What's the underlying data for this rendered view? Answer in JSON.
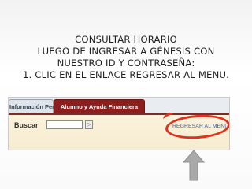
{
  "instructions": {
    "line1": "CONSULTAR HORARIO",
    "line2": "LUEGO DE INGRESAR A GÉNESIS CON",
    "line3": "NUESTRO ID Y CONTRASEÑA:",
    "line4": "1. CLIC EN EL ENLACE REGRESAR AL MENU."
  },
  "screenshot": {
    "tabs": [
      {
        "label": "Información Personal"
      },
      {
        "label": "Alumno y Ayuda Financiera"
      }
    ],
    "search_label": "Buscar",
    "search_value": "",
    "go_button_label": "▷",
    "return_link": "REGRESAR AL MENÚ"
  },
  "colors": {
    "active_tab": "#8c1e1e",
    "highlight_ring": "#e0321f",
    "arrow_fill": "#a9a9a9"
  },
  "icons": {
    "arrow": "up-arrow-icon"
  }
}
